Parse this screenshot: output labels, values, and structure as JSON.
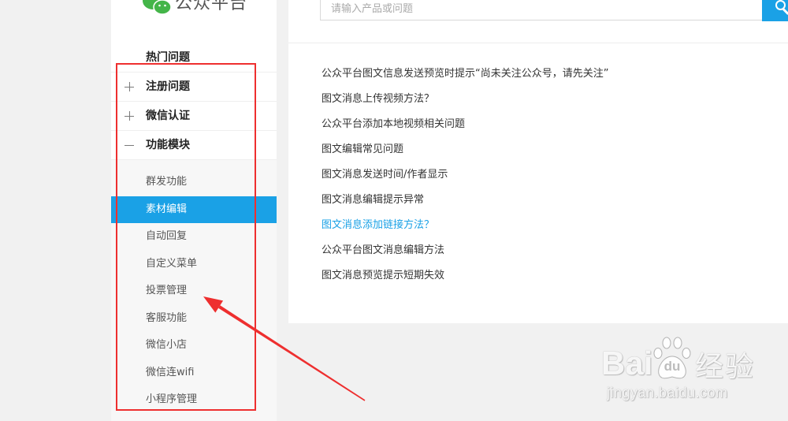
{
  "header": {
    "logo_text": "公众平台",
    "search": {
      "placeholder": "请输入产品或问题",
      "button_icon": "search-icon"
    }
  },
  "sidebar": {
    "menu": [
      {
        "label": "热门问题"
      },
      {
        "label": "注册问题",
        "icon": "plus-icon",
        "expanded": false
      },
      {
        "label": "微信认证",
        "icon": "plus-icon",
        "expanded": false
      },
      {
        "label": "功能模块",
        "icon": "minus-icon",
        "expanded": true
      }
    ],
    "sub_items": [
      {
        "label": "群发功能",
        "active": false
      },
      {
        "label": "素材编辑",
        "active": true
      },
      {
        "label": "自动回复",
        "active": false
      },
      {
        "label": "自定义菜单",
        "active": false
      },
      {
        "label": "投票管理",
        "active": false
      },
      {
        "label": "客服功能",
        "active": false
      },
      {
        "label": "微信小店",
        "active": false
      },
      {
        "label": "微信连wifi",
        "active": false
      },
      {
        "label": "小程序管理",
        "active": false
      }
    ]
  },
  "articles": [
    {
      "title": "公众平台图文信息发送预览时提示“尚未关注公众号，请先关注”",
      "highlighted": false
    },
    {
      "title": "图文消息上传视频方法？",
      "highlighted": false
    },
    {
      "title": "公众平台添加本地视频相关问题",
      "highlighted": false
    },
    {
      "title": "图文编辑常见问题",
      "highlighted": false
    },
    {
      "title": "图文消息发送时间/作者显示",
      "highlighted": false
    },
    {
      "title": "图文消息编辑提示异常",
      "highlighted": false
    },
    {
      "title": "图文消息添加链接方法？",
      "highlighted": true
    },
    {
      "title": "公众平台图文消息编辑方法",
      "highlighted": false
    },
    {
      "title": "图文消息预览提示短期失效",
      "highlighted": false
    }
  ],
  "watermark": {
    "brand_left": "Bai",
    "brand_paw_text": "du",
    "brand_cn": "经验",
    "url": "jingyan.baidu.com"
  },
  "colors": {
    "accent": "#1aa1e6",
    "annotation_red": "#ee2f2f",
    "wechat_green": "#44b549",
    "page_bg": "#f1f1f1"
  }
}
